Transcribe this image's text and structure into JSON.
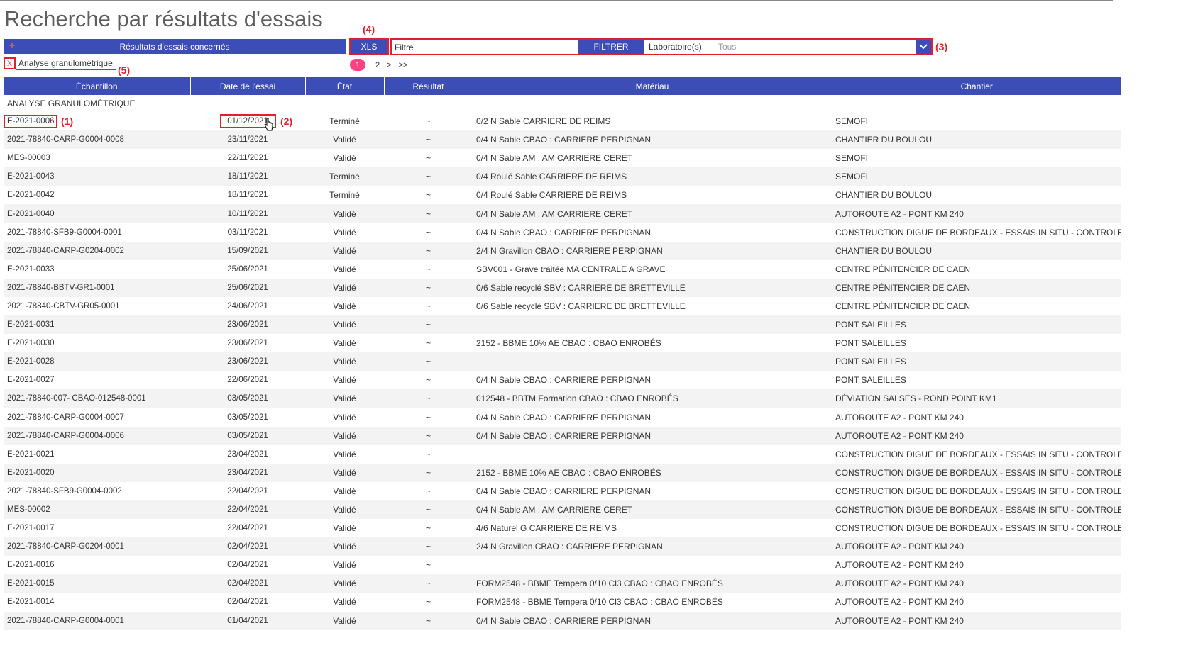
{
  "page": {
    "title": "Recherche par résultats d'essais"
  },
  "toolbar": {
    "concerned_label": "Résultats d'essais concernés",
    "concerned_plus": "+",
    "xls_label": "XLS",
    "filter_placeholder": "Filtre",
    "filter_value": "",
    "filtrer_label": "FILTRER",
    "laboratory_label": "Laboratoire(s)",
    "laboratory_value": "Tous"
  },
  "selected_filter": {
    "remove_label": "X",
    "label": "Analyse granulométrique"
  },
  "pagination": {
    "pages": [
      "1",
      "2"
    ],
    "current": "1",
    "next": ">",
    "last": ">>"
  },
  "annotations": [
    "(1)",
    "(2)",
    "(3)",
    "(4)",
    "(5)"
  ],
  "table": {
    "columns": [
      "Échantillon",
      "Date de l'essai",
      "État",
      "Résultat",
      "Matériau",
      "Chantier"
    ],
    "group_label": "ANALYSE GRANULOMÉTRIQUE",
    "rows": [
      [
        "E-2021-0006",
        "01/12/2021",
        "Terminé",
        "~",
        "0/2 N Sable CARRIERE DE REIMS",
        "SEMOFI"
      ],
      [
        "2021-78840-CARP-G0004-0008",
        "23/11/2021",
        "Validé",
        "~",
        "0/4 N Sable CBAO : CARRIERE PERPIGNAN",
        "CHANTIER DU BOULOU"
      ],
      [
        "MES-00003",
        "22/11/2021",
        "Validé",
        "~",
        "0/4 N Sable AM : AM CARRIERE CERET",
        "SEMOFI"
      ],
      [
        "E-2021-0043",
        "18/11/2021",
        "Terminé",
        "~",
        "0/4 Roulé Sable CARRIERE DE REIMS",
        "SEMOFI"
      ],
      [
        "E-2021-0042",
        "18/11/2021",
        "Terminé",
        "~",
        "0/4 Roulé Sable CARRIERE DE REIMS",
        "CHANTIER DU BOULOU"
      ],
      [
        "E-2021-0040",
        "10/11/2021",
        "Validé",
        "~",
        "0/4 N Sable AM : AM CARRIERE CERET",
        "AUTOROUTE A2 - PONT KM 240"
      ],
      [
        "2021-78840-SFB9-G0004-0001",
        "03/11/2021",
        "Validé",
        "~",
        "0/4 N Sable CBAO : CARRIERE PERPIGNAN",
        "CONSTRUCTION DIGUE DE BORDEAUX - ESSAIS IN SITU - CONTROLE CO"
      ],
      [
        "2021-78840-CARP-G0204-0002",
        "15/09/2021",
        "Validé",
        "~",
        "2/4 N Gravillon CBAO : CARRIERE PERPIGNAN",
        "CHANTIER DU BOULOU"
      ],
      [
        "E-2021-0033",
        "25/06/2021",
        "Validé",
        "~",
        "SBV001 - Grave traitée MA CENTRALE A GRAVE",
        "CENTRE PÉNITENCIER DE CAEN"
      ],
      [
        "2021-78840-BBTV-GR1-0001",
        "25/06/2021",
        "Validé",
        "~",
        "0/6 Sable recyclé SBV : CARRIERE DE BRETTEVILLE",
        "CENTRE PÉNITENCIER DE CAEN"
      ],
      [
        "2021-78840-CBTV-GR05-0001",
        "24/06/2021",
        "Validé",
        "~",
        "0/6 Sable recyclé SBV : CARRIERE DE BRETTEVILLE",
        "CENTRE PÉNITENCIER DE CAEN"
      ],
      [
        "E-2021-0031",
        "23/06/2021",
        "Validé",
        "~",
        "",
        "PONT SALEILLES"
      ],
      [
        "E-2021-0030",
        "23/06/2021",
        "Validé",
        "~",
        "2152 - BBME 10% AE CBAO : CBAO ENROBÉS",
        "PONT SALEILLES"
      ],
      [
        "E-2021-0028",
        "23/06/2021",
        "Validé",
        "~",
        "",
        "PONT SALEILLES"
      ],
      [
        "E-2021-0027",
        "22/06/2021",
        "Validé",
        "~",
        "0/4 N Sable CBAO : CARRIERE PERPIGNAN",
        "PONT SALEILLES"
      ],
      [
        "2021-78840-007- CBAO-012548-0001",
        "03/05/2021",
        "Validé",
        "~",
        "012548 - BBTM Formation CBAO : CBAO ENROBÉS",
        "DÉVIATION SALSES - ROND POINT KM1"
      ],
      [
        "2021-78840-CARP-G0004-0007",
        "03/05/2021",
        "Validé",
        "~",
        "0/4 N Sable CBAO : CARRIERE PERPIGNAN",
        "AUTOROUTE A2 - PONT KM 240"
      ],
      [
        "2021-78840-CARP-G0004-0006",
        "03/05/2021",
        "Validé",
        "~",
        "0/4 N Sable CBAO : CARRIERE PERPIGNAN",
        "AUTOROUTE A2 - PONT KM 240"
      ],
      [
        "E-2021-0021",
        "23/04/2021",
        "Validé",
        "~",
        "",
        "CONSTRUCTION DIGUE DE BORDEAUX - ESSAIS IN SITU - CONTROLE CO"
      ],
      [
        "E-2021-0020",
        "23/04/2021",
        "Validé",
        "~",
        "2152 - BBME 10% AE CBAO : CBAO ENROBÉS",
        "CONSTRUCTION DIGUE DE BORDEAUX - ESSAIS IN SITU - CONTROLE CO"
      ],
      [
        "2021-78840-SFB9-G0004-0002",
        "22/04/2021",
        "Validé",
        "~",
        "0/4 N Sable CBAO : CARRIERE PERPIGNAN",
        "CONSTRUCTION DIGUE DE BORDEAUX - ESSAIS IN SITU - CONTROLE CO"
      ],
      [
        "MES-00002",
        "22/04/2021",
        "Validé",
        "~",
        "0/4 N Sable AM : AM CARRIERE CERET",
        "CONSTRUCTION DIGUE DE BORDEAUX - ESSAIS IN SITU - CONTROLE CO"
      ],
      [
        "E-2021-0017",
        "22/04/2021",
        "Validé",
        "~",
        "4/6 Naturel G CARRIERE DE REIMS",
        "CONSTRUCTION DIGUE DE BORDEAUX - ESSAIS IN SITU - CONTROLE CO"
      ],
      [
        "2021-78840-CARP-G0204-0001",
        "02/04/2021",
        "Validé",
        "~",
        "2/4 N Gravillon CBAO : CARRIERE PERPIGNAN",
        "AUTOROUTE A2 - PONT KM 240"
      ],
      [
        "E-2021-0016",
        "02/04/2021",
        "Validé",
        "~",
        "",
        "AUTOROUTE A2 - PONT KM 240"
      ],
      [
        "E-2021-0015",
        "02/04/2021",
        "Validé",
        "~",
        "FORM2548 - BBME Tempera 0/10 Cl3 CBAO : CBAO ENROBÉS",
        "AUTOROUTE A2 - PONT KM 240"
      ],
      [
        "E-2021-0014",
        "02/04/2021",
        "Validé",
        "~",
        "FORM2548 - BBME Tempera 0/10 Cl3 CBAO : CBAO ENROBÉS",
        "AUTOROUTE A2 - PONT KM 240"
      ],
      [
        "2021-78840-CARP-G0004-0001",
        "01/04/2021",
        "Validé",
        "~",
        "0/4 N Sable CBAO : CARRIERE PERPIGNAN",
        "AUTOROUTE A2 - PONT KM 240"
      ]
    ]
  },
  "colors": {
    "header_blue": "#3d4db7",
    "accent_pink": "#ff4081",
    "link_pink": "#e83e6c",
    "annotation_red": "#e0202a"
  }
}
